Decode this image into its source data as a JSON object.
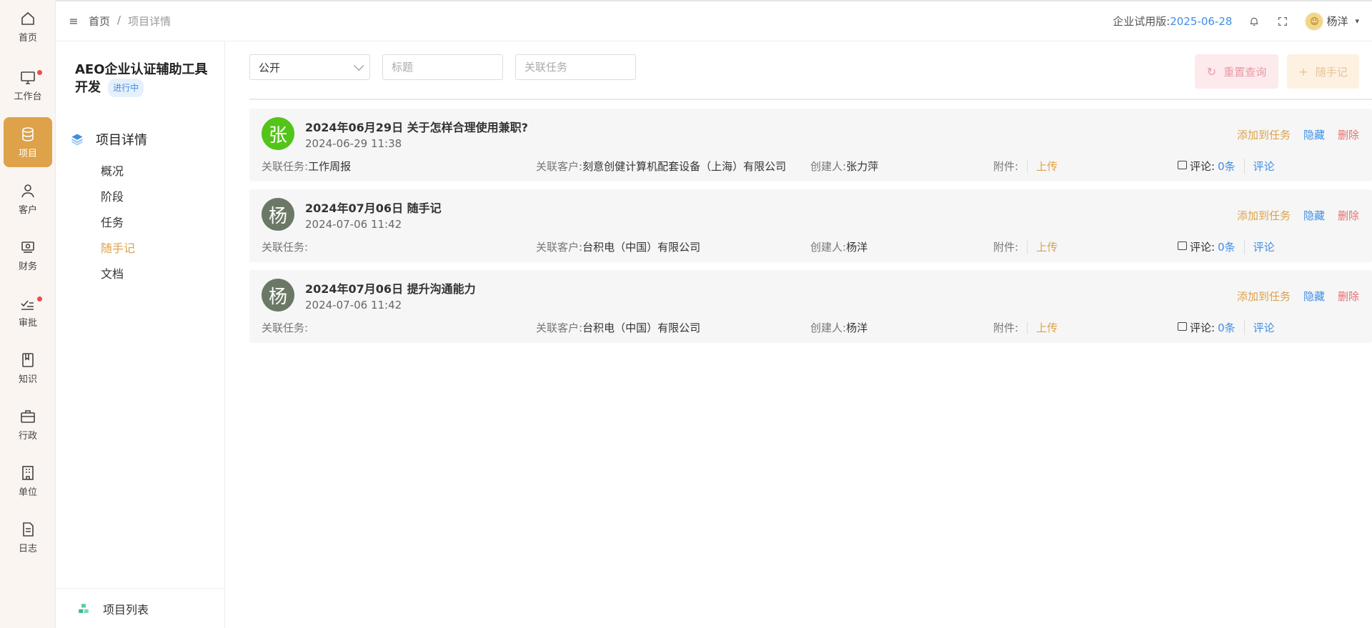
{
  "rail": {
    "items": [
      {
        "label": "首页",
        "icon": "home-icon"
      },
      {
        "label": "工作台",
        "icon": "monitor-icon",
        "dot": true
      },
      {
        "label": "项目",
        "icon": "database-icon",
        "active": true
      },
      {
        "label": "客户",
        "icon": "user-icon"
      },
      {
        "label": "财务",
        "icon": "wallet-icon"
      },
      {
        "label": "审批",
        "icon": "check-list-icon",
        "dot": true
      },
      {
        "label": "知识",
        "icon": "book-icon"
      },
      {
        "label": "行政",
        "icon": "briefcase-icon"
      },
      {
        "label": "单位",
        "icon": "building-icon"
      },
      {
        "label": "日志",
        "icon": "document-icon"
      }
    ]
  },
  "header": {
    "breadcrumb": [
      "首页",
      "项目详情"
    ],
    "breadcrumb_sep": "/",
    "trial_label": "企业试用版:",
    "trial_date": "2025-06-28",
    "user_name": "杨洋"
  },
  "sidebar": {
    "project_title": "AEO企业认证辅助工具开发",
    "status": "进行中",
    "section_title": "项目详情",
    "nav": [
      "概况",
      "阶段",
      "任务",
      "随手记",
      "文档"
    ],
    "active_nav": "随手记",
    "footer_label": "项目列表"
  },
  "filters": {
    "visibility_value": "公开",
    "title_placeholder": "标题",
    "task_placeholder": "关联任务",
    "reset_label": "重置查询",
    "add_label": "随手记"
  },
  "labels": {
    "task": "关联任务:",
    "customer": "关联客户:",
    "creator": "创建人:",
    "attachment": "附件:",
    "upload": "上传",
    "comments": "评论:",
    "comment_link": "评论",
    "add_to_task": "添加到任务",
    "hide": "隐藏",
    "delete": "删除"
  },
  "notes": [
    {
      "avatar": "张",
      "avatar_color": "#52c41a",
      "title": "2024年06月29日 关于怎样合理使用兼职?",
      "time": "2024-06-29 11:38",
      "task": "工作周报",
      "customer": "刻意创健计算机配套设备（上海）有限公司",
      "creator": "张力萍",
      "comment_count": "0条"
    },
    {
      "avatar": "杨",
      "avatar_color": "#6b7866",
      "title": "2024年07月06日 随手记",
      "time": "2024-07-06 11:42",
      "task": "",
      "customer": "台积电（中国）有限公司",
      "creator": "杨洋",
      "comment_count": "0条"
    },
    {
      "avatar": "杨",
      "avatar_color": "#6b7866",
      "title": "2024年07月06日 提升沟通能力",
      "time": "2024-07-06 11:42",
      "task": "",
      "customer": "台积电（中国）有限公司",
      "creator": "杨洋",
      "comment_count": "0条"
    }
  ],
  "colors": {
    "accent": "#dda24a",
    "link": "#3f8ee6",
    "danger": "#e86e6e"
  }
}
